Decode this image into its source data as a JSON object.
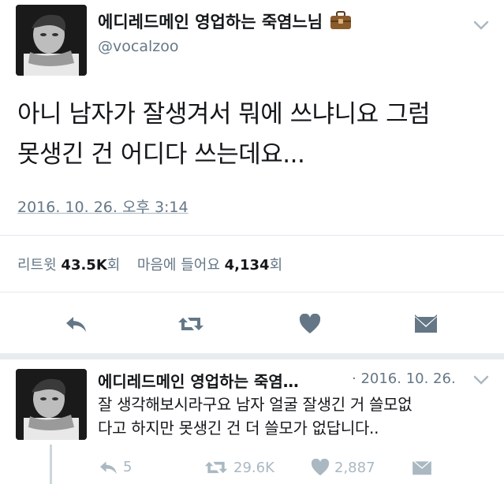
{
  "tweet": {
    "display_name": "에디레드메인 영업하는 죽염느님",
    "name_emoji": "briefcase-emoji",
    "handle": "@vocalzoo",
    "text_line1": "아니 남자가 잘생겨서 뭐에 쓰냐니요 그럼",
    "text_line2": "못생긴 건 어디다 쓰는데요...",
    "timestamp": "2016. 10. 26. 오후 3:14",
    "retweets_label": "리트윗",
    "retweets_count": "43.5K",
    "retweets_unit": "회",
    "likes_label": "마음에 들어요",
    "likes_count": "4,134",
    "likes_unit": "회",
    "icons": [
      "reply-icon",
      "retweet-icon",
      "heart-icon",
      "dm-icon"
    ]
  },
  "reply": {
    "display_name": "에디레드메인 영업하는 죽염…",
    "date": "· 2016. 10. 26.",
    "text_line1": "잘 생각해보시라구요 남자 얼굴 잘생긴 거 쓸모없",
    "text_line2": "다고 하지만 못생긴 건 더 쓸모가 없답니다..",
    "reply_count": "5",
    "retweet_count": "29.6K",
    "like_count": "2,887"
  },
  "colors": {
    "text": "#14171a",
    "secondary": "#657786",
    "muted": "#aab8c2",
    "divider": "#e1e8ed",
    "briefcase": "#8b5a2b"
  }
}
